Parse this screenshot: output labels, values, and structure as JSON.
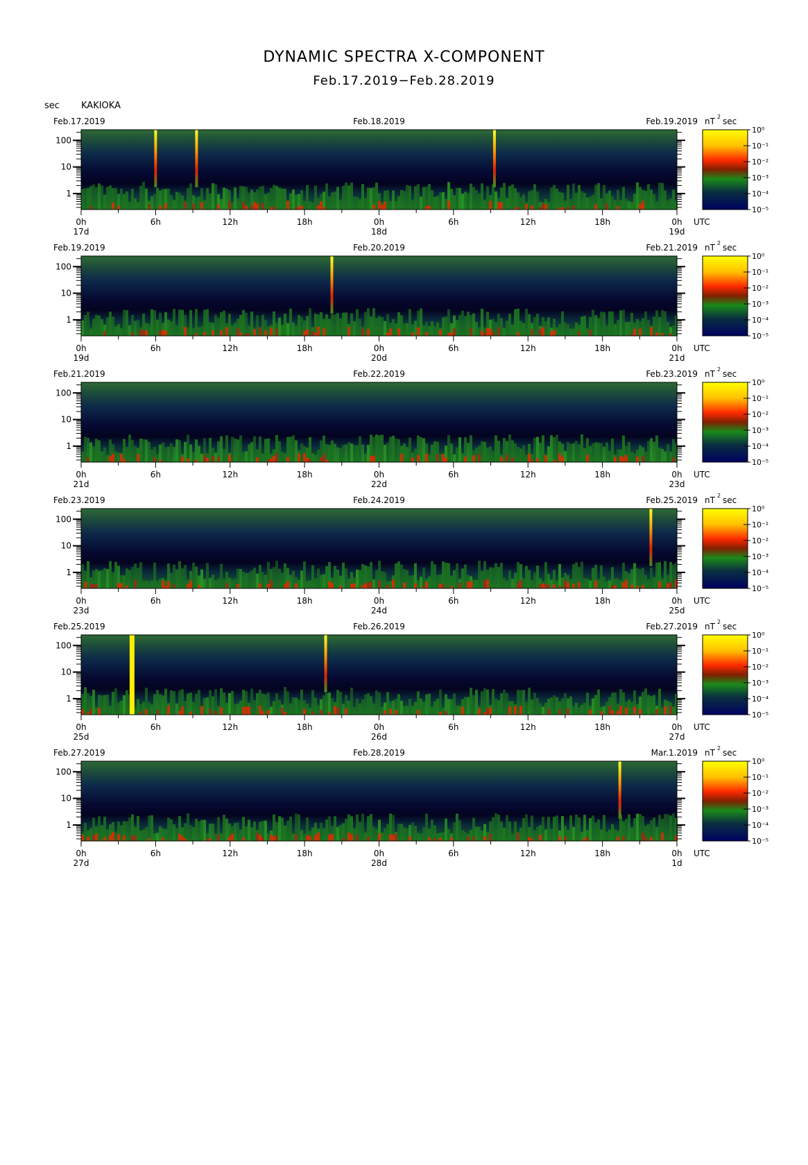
{
  "title": "DYNAMIC SPECTRA X-COMPONENT",
  "subtitle": "Feb.17.2019−Feb.28.2019",
  "unit_label": "sec",
  "station": "KAKIOKA",
  "colorbar_unit": "nT",
  "colorbar_unit_exp": "2",
  "colorbar_unit_suffix": "sec",
  "colors": {
    "low": "#000060",
    "mid1": "#0a4a2a",
    "mid2": "#1a8a1a",
    "mid3": "#ff2a00",
    "high": "#ffff00"
  },
  "chart_data": [
    {
      "type": "heatmap",
      "dates": [
        "Feb.17.2019",
        "Feb.18.2019",
        "Feb.19.2019"
      ],
      "x_ticks": [
        "0h",
        "6h",
        "12h",
        "18h",
        "0h",
        "6h",
        "12h",
        "18h",
        "0h"
      ],
      "day_labels": [
        "17d",
        "18d",
        "19d"
      ],
      "x_unit": "UTC",
      "y_ticks": [
        "1",
        "10",
        "100"
      ],
      "y_scale": "log",
      "colorbar_ticks": [
        "10⁰",
        "10⁻¹",
        "10⁻²",
        "10⁻³",
        "10⁻⁴",
        "10⁻⁵"
      ],
      "spikes_hours": [
        6.0,
        9.3,
        33.3
      ]
    },
    {
      "type": "heatmap",
      "dates": [
        "Feb.19.2019",
        "Feb.20.2019",
        "Feb.21.2019"
      ],
      "x_ticks": [
        "0h",
        "6h",
        "12h",
        "18h",
        "0h",
        "6h",
        "12h",
        "18h",
        "0h"
      ],
      "day_labels": [
        "19d",
        "20d",
        "21d"
      ],
      "x_unit": "UTC",
      "y_ticks": [
        "1",
        "10",
        "100"
      ],
      "y_scale": "log",
      "colorbar_ticks": [
        "10⁰",
        "10⁻¹",
        "10⁻²",
        "10⁻³",
        "10⁻⁴",
        "10⁻⁵"
      ],
      "spikes_hours": [
        20.2
      ]
    },
    {
      "type": "heatmap",
      "dates": [
        "Feb.21.2019",
        "Feb.22.2019",
        "Feb.23.2019"
      ],
      "x_ticks": [
        "0h",
        "6h",
        "12h",
        "18h",
        "0h",
        "6h",
        "12h",
        "18h",
        "0h"
      ],
      "day_labels": [
        "21d",
        "22d",
        "23d"
      ],
      "x_unit": "UTC",
      "y_ticks": [
        "1",
        "10",
        "100"
      ],
      "y_scale": "log",
      "colorbar_ticks": [
        "10⁰",
        "10⁻¹",
        "10⁻²",
        "10⁻³",
        "10⁻⁴",
        "10⁻⁵"
      ],
      "spikes_hours": []
    },
    {
      "type": "heatmap",
      "dates": [
        "Feb.23.2019",
        "Feb.24.2019",
        "Feb.25.2019"
      ],
      "x_ticks": [
        "0h",
        "6h",
        "12h",
        "18h",
        "0h",
        "6h",
        "12h",
        "18h",
        "0h"
      ],
      "day_labels": [
        "23d",
        "24d",
        "25d"
      ],
      "x_unit": "UTC",
      "y_ticks": [
        "1",
        "10",
        "100"
      ],
      "y_scale": "log",
      "colorbar_ticks": [
        "10⁰",
        "10⁻¹",
        "10⁻²",
        "10⁻³",
        "10⁻⁴",
        "10⁻⁵"
      ],
      "spikes_hours": [
        45.9
      ]
    },
    {
      "type": "heatmap",
      "dates": [
        "Feb.25.2019",
        "Feb.26.2019",
        "Feb.27.2019"
      ],
      "x_ticks": [
        "0h",
        "6h",
        "12h",
        "18h",
        "0h",
        "6h",
        "12h",
        "18h",
        "0h"
      ],
      "day_labels": [
        "25d",
        "26d",
        "27d"
      ],
      "x_unit": "UTC",
      "y_ticks": [
        "1",
        "10",
        "100"
      ],
      "y_scale": "log",
      "colorbar_ticks": [
        "10⁰",
        "10⁻¹",
        "10⁻²",
        "10⁻³",
        "10⁻⁴",
        "10⁻⁵"
      ],
      "spikes_hours": [
        4.1,
        19.7
      ]
    },
    {
      "type": "heatmap",
      "dates": [
        "Feb.27.2019",
        "Feb.28.2019",
        "Mar.1.2019"
      ],
      "x_ticks": [
        "0h",
        "6h",
        "12h",
        "18h",
        "0h",
        "6h",
        "12h",
        "18h",
        "0h"
      ],
      "day_labels": [
        "27d",
        "28d",
        "1d"
      ],
      "x_unit": "UTC",
      "y_ticks": [
        "1",
        "10",
        "100"
      ],
      "y_scale": "log",
      "colorbar_ticks": [
        "10⁰",
        "10⁻¹",
        "10⁻²",
        "10⁻³",
        "10⁻⁴",
        "10⁻⁵"
      ],
      "spikes_hours": [
        43.4
      ]
    }
  ]
}
